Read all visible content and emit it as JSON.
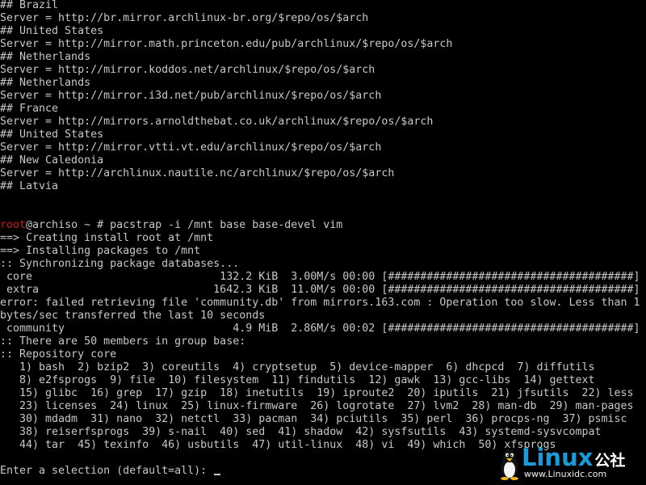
{
  "terminal": {
    "lines": [
      [
        {
          "t": "## Brazil"
        }
      ],
      [
        {
          "t": "Server = http://br.mirror.archlinux-br.org/$repo/os/$arch"
        }
      ],
      [
        {
          "t": "## United States"
        }
      ],
      [
        {
          "t": "Server = http://mirror.math.princeton.edu/pub/archlinux/$repo/os/$arch"
        }
      ],
      [
        {
          "t": "## Netherlands"
        }
      ],
      [
        {
          "t": "Server = http://mirror.koddos.net/archlinux/$repo/os/$arch"
        }
      ],
      [
        {
          "t": "## Netherlands"
        }
      ],
      [
        {
          "t": "Server = http://mirror.i3d.net/pub/archlinux/$repo/os/$arch"
        }
      ],
      [
        {
          "t": "## France"
        }
      ],
      [
        {
          "t": "Server = http://mirrors.arnoldthebat.co.uk/archlinux/$repo/os/$arch"
        }
      ],
      [
        {
          "t": "## United States"
        }
      ],
      [
        {
          "t": "Server = http://mirror.vtti.vt.edu/archlinux/$repo/os/$arch"
        }
      ],
      [
        {
          "t": "## New Caledonia"
        }
      ],
      [
        {
          "t": "Server = http://archlinux.nautile.nc/archlinux/$repo/os/$arch"
        }
      ],
      [
        {
          "t": "## Latvia"
        }
      ],
      [
        {
          "t": ""
        }
      ],
      [
        {
          "t": ""
        }
      ],
      [
        {
          "t": "root",
          "c": "red"
        },
        {
          "t": "@archiso ~ # pacstrap -i /mnt base base-devel vim"
        }
      ],
      [
        {
          "t": "==> Creating install root at /mnt"
        }
      ],
      [
        {
          "t": "==> Installing packages to /mnt"
        }
      ],
      [
        {
          "t": ":: Synchronizing package databases..."
        }
      ],
      [
        {
          "t": " core                             132.2 KiB  3.00M/s 00:00 [######################################] 100%"
        }
      ],
      [
        {
          "t": " extra                           1642.3 KiB  11.0M/s 00:00 [######################################] 100%"
        }
      ],
      [
        {
          "t": "error: failed retrieving file 'community.db' from mirrors.163.com : Operation too slow. Less than 1"
        }
      ],
      [
        {
          "t": "bytes/sec transferred the last 10 seconds"
        }
      ],
      [
        {
          "t": " community                          4.9 MiB  2.86M/s 00:02 [######################################] 100%"
        }
      ],
      [
        {
          "t": ":: There are 50 members in group base:"
        }
      ],
      [
        {
          "t": ":: Repository core"
        }
      ],
      [
        {
          "t": "   1) bash  2) bzip2  3) coreutils  4) cryptsetup  5) device-mapper  6) dhcpcd  7) diffutils"
        }
      ],
      [
        {
          "t": "   8) e2fsprogs  9) file  10) filesystem  11) findutils  12) gawk  13) gcc-libs  14) gettext"
        }
      ],
      [
        {
          "t": "   15) glibc  16) grep  17) gzip  18) inetutils  19) iproute2  20) iputils  21) jfsutils  22) less"
        }
      ],
      [
        {
          "t": "   23) licenses  24) linux  25) linux-firmware  26) logrotate  27) lvm2  28) man-db  29) man-pages"
        }
      ],
      [
        {
          "t": "   30) mdadm  31) nano  32) netctl  33) pacman  34) pciutils  35) perl  36) procps-ng  37) psmisc"
        }
      ],
      [
        {
          "t": "   38) reiserfsprogs  39) s-nail  40) sed  41) shadow  42) sysfsutils  43) systemd-sysvcompat"
        }
      ],
      [
        {
          "t": "   44) tar  45) texinfo  46) usbutils  47) util-linux  48) vi  49) which  50) xfsprogs"
        }
      ],
      [
        {
          "t": ""
        }
      ],
      [
        {
          "t": "Enter a selection (default=all): "
        }
      ]
    ]
  },
  "watermark": {
    "brand": "Linux",
    "brand_cn": "公社",
    "url": "www.Linuxidc.com"
  },
  "colors": {
    "background": "#000000",
    "text": "#c8c8c8",
    "prompt_user": "#d41818",
    "brand": "#1a9ad6"
  }
}
